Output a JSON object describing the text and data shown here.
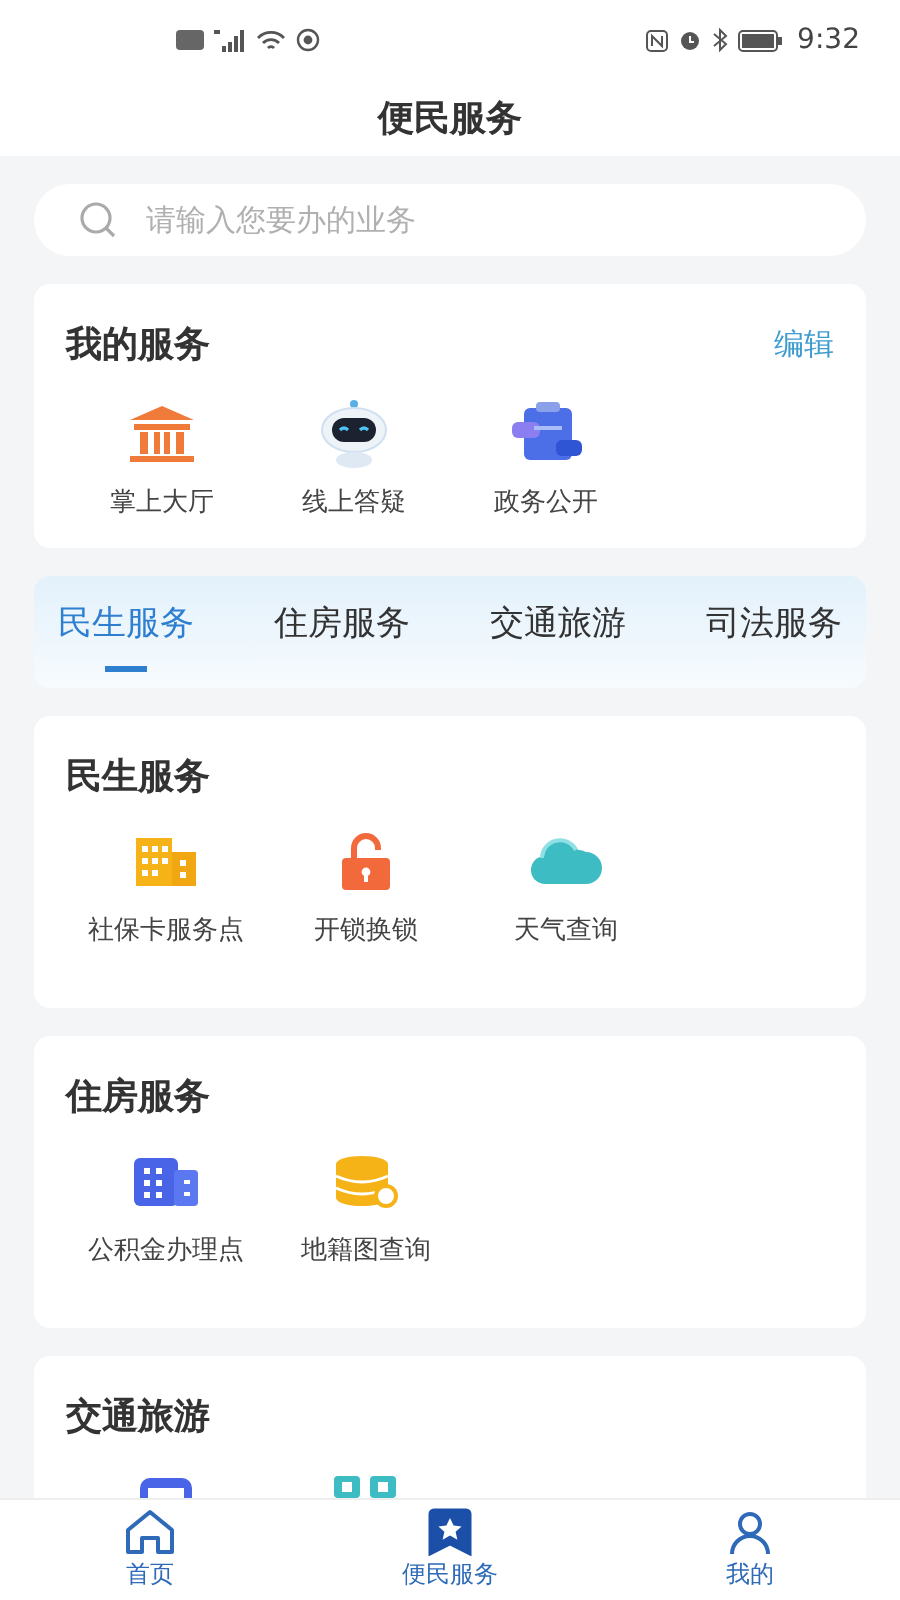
{
  "status_bar": {
    "time": "9:32"
  },
  "header": {
    "title": "便民服务"
  },
  "search": {
    "placeholder": "请输入您要办的业务"
  },
  "my_services": {
    "title": "我的服务",
    "edit": "编辑",
    "items": [
      {
        "label": "掌上大厅"
      },
      {
        "label": "线上答疑"
      },
      {
        "label": "政务公开"
      }
    ]
  },
  "tabs": [
    {
      "label": "民生服务",
      "selected": true
    },
    {
      "label": "住房服务",
      "selected": false
    },
    {
      "label": "交通旅游",
      "selected": false
    },
    {
      "label": "司法服务",
      "selected": false
    }
  ],
  "sections": [
    {
      "title": "民生服务",
      "items": [
        {
          "label": "社保卡服务点"
        },
        {
          "label": "开锁换锁"
        },
        {
          "label": "天气查询"
        }
      ]
    },
    {
      "title": "住房服务",
      "items": [
        {
          "label": "公积金办理点"
        },
        {
          "label": "地籍图查询"
        }
      ]
    },
    {
      "title": "交通旅游"
    }
  ],
  "bottom_nav": [
    {
      "label": "首页",
      "selected": false
    },
    {
      "label": "便民服务",
      "selected": true
    },
    {
      "label": "我的",
      "selected": false
    }
  ]
}
